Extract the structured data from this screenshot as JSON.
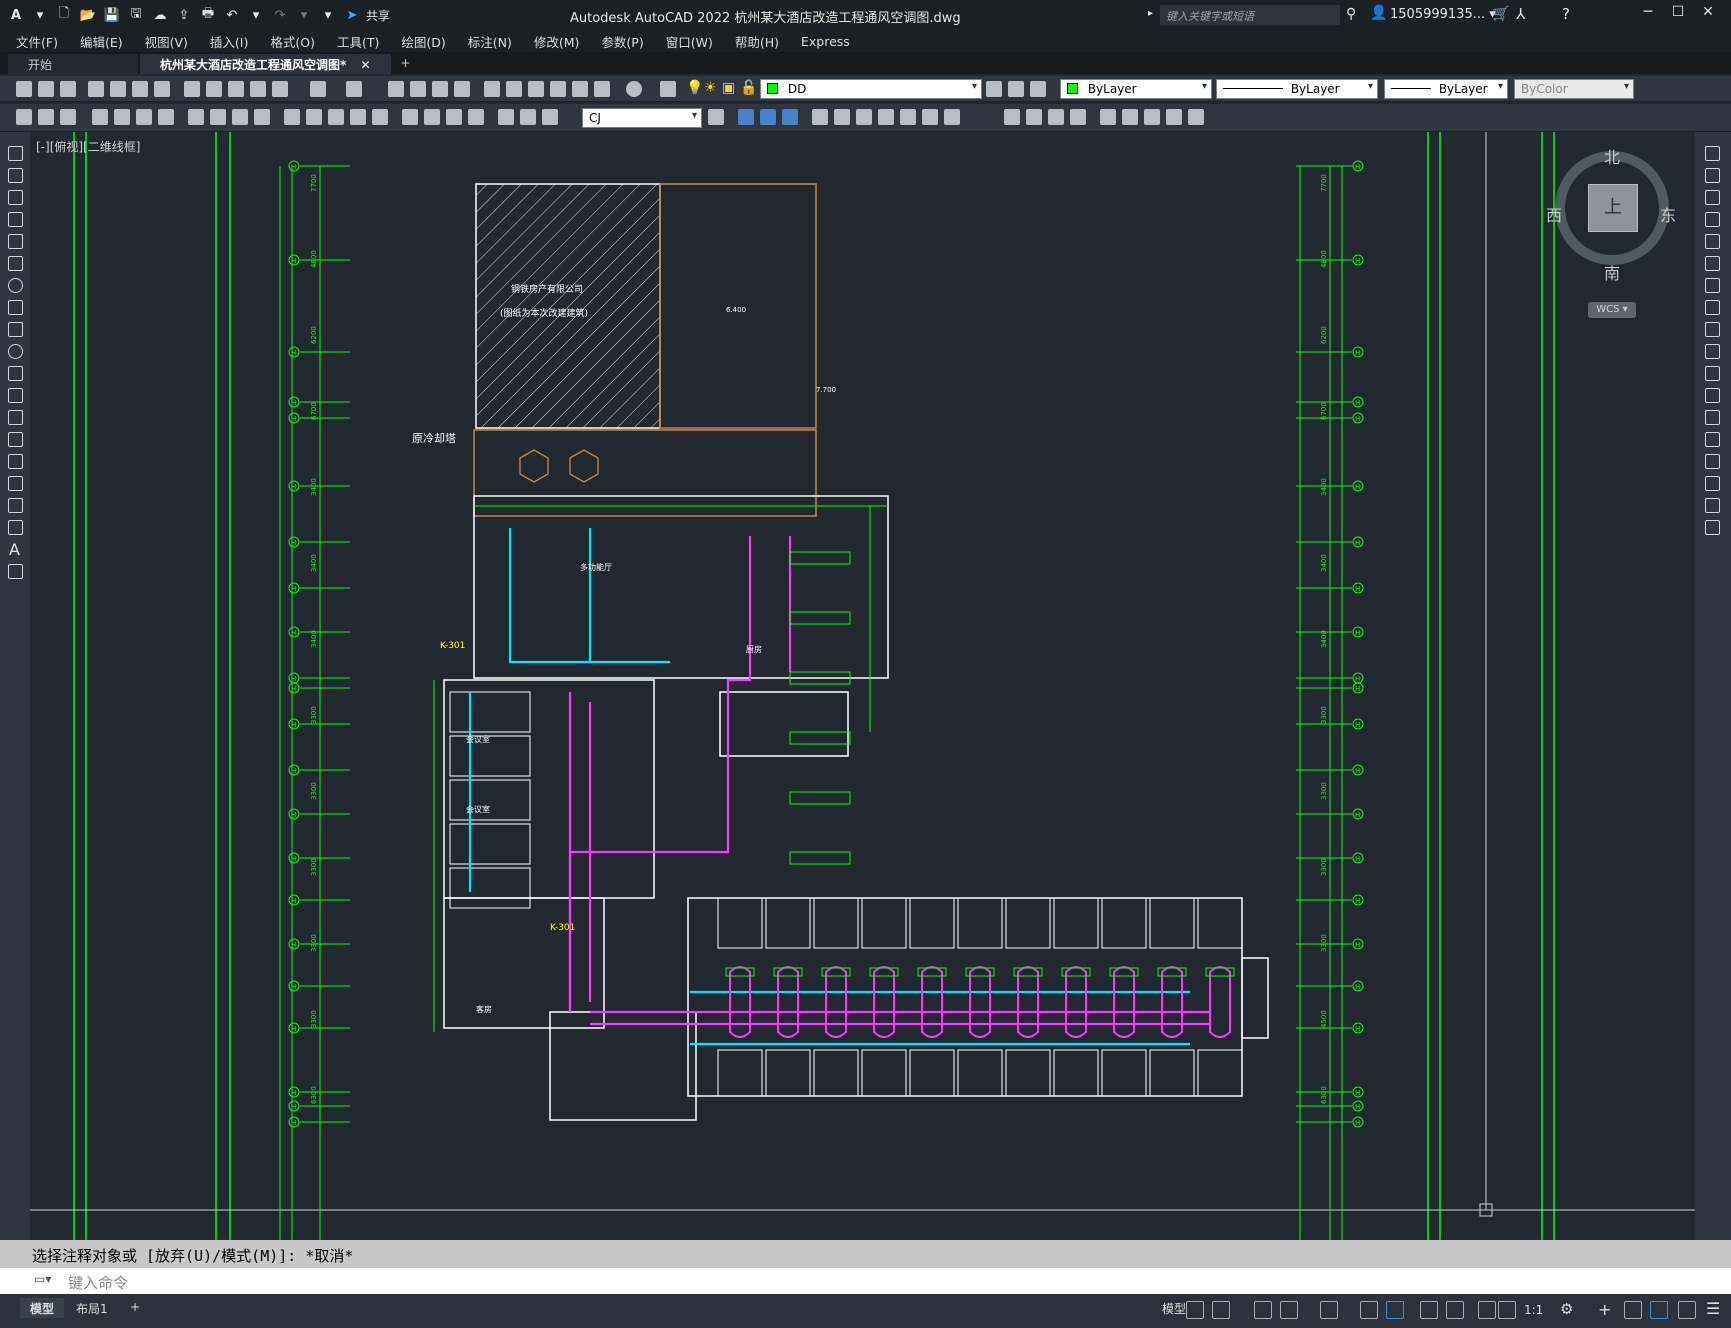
{
  "window": {
    "app_title": "Autodesk AutoCAD 2022    杭州某大酒店改造工程通风空调图.dwg",
    "share_label": "共享",
    "search_placeholder": "键入关键字或短语",
    "user_name": "1505999135...",
    "minimize": "─",
    "restore": "☐",
    "close": "✕"
  },
  "menu": [
    "文件(F)",
    "编辑(E)",
    "视图(V)",
    "插入(I)",
    "格式(O)",
    "工具(T)",
    "绘图(D)",
    "标注(N)",
    "修改(M)",
    "参数(P)",
    "窗口(W)",
    "帮助(H)",
    "Express"
  ],
  "tabs": {
    "start": "开始",
    "drawing": "杭州某大酒店改造工程通风空调图*",
    "close": "✕",
    "new": "+"
  },
  "layers_toolbar": {
    "layer": "DD",
    "color": "ByLayer",
    "linetype": "ByLayer",
    "lineweight": "ByLayer",
    "plotstyle": "ByColor",
    "color_swatch": "#00ff00"
  },
  "dim_toolbar": {
    "dimstyle": "CJ"
  },
  "viewport": {
    "label": "[-][俯视][二维线框]"
  },
  "drawing": {
    "building_note_1": "钢铁房产有限公司",
    "building_note_2": "(图纸为本次改建建筑)",
    "cooling_tower": "原冷却塔",
    "level_1": "6.400",
    "level_2": "7.700",
    "unit_k301": "K-301",
    "room_guest": "客房",
    "room_meeting": "会议室",
    "room_multi": "多功能厅",
    "room_kitchen": "厨房",
    "axis_tag": "H",
    "dims_left": [
      "7700",
      "4800",
      "6200",
      "6700",
      "3400",
      "3400",
      "3400",
      "3300",
      "3300",
      "3300",
      "3300",
      "3300",
      "6300"
    ],
    "dims_right": [
      "7700",
      "4800",
      "6200",
      "6700",
      "3400",
      "3400",
      "3400",
      "3300",
      "3300",
      "3300",
      "3300",
      "4500",
      "6300"
    ]
  },
  "viewcube": {
    "north": "北",
    "south": "南",
    "east": "东",
    "west": "西",
    "top": "上",
    "wcs": "WCS"
  },
  "command": {
    "history": "选择注释对象或 [放弃(U)/模式(M)]: *取消*",
    "input_placeholder": "键入命令"
  },
  "statusbar": {
    "tab_model": "模型",
    "tab_layout": "布局1",
    "add": "+",
    "model_btn": "模型",
    "scale": "1:1"
  }
}
